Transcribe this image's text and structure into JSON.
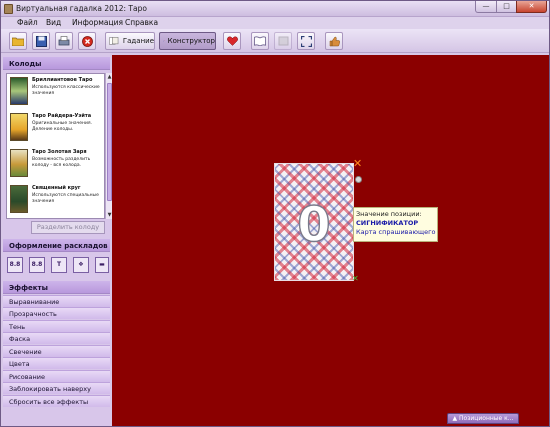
{
  "window": {
    "title": "Виртуальная гадалка 2012: Таро",
    "minimize_glyph": "—",
    "maximize_glyph": "□",
    "close_glyph": "✕"
  },
  "menu": [
    "Файл",
    "Вид",
    "Информация",
    "Справка"
  ],
  "toolbar": {
    "fortune_label": "Гадание",
    "constructor_label": "Конструктор",
    "icons": [
      "open-folder-icon",
      "save-icon",
      "print-icon",
      "stop-icon",
      "fortune-icon",
      "constructor-icon",
      "heart-icon",
      "book-icon",
      "disabled-icon",
      "fullscreen-icon",
      "thumbs-up-icon"
    ]
  },
  "sidebar": {
    "decks_header": "Колоды",
    "decks": [
      {
        "name": "Бриллиантовое Таро",
        "desc": "Используются классические значения"
      },
      {
        "name": "Таро Райдера-Уэйта",
        "desc": "Оригинальные значения. Деление колоды."
      },
      {
        "name": "Таро Золотая Заря",
        "desc": "Возможность разделить колоду - вся колода."
      },
      {
        "name": "Священный круг",
        "desc": "Используются специальные значения"
      }
    ],
    "split_button": "Разделить колоду",
    "layout_header": "Оформление раскладов",
    "effects_header": "Эффекты",
    "effects": [
      "Выравнивание",
      "Прозрачность",
      "Тень",
      "Фаска",
      "Свечение",
      "Цвета",
      "Рисование",
      "Заблокировать наверху",
      "Сбросить все эффекты"
    ]
  },
  "canvas": {
    "background_color": "#8b0000",
    "card_number": "0",
    "tooltip": {
      "line1": "Значение позиции:",
      "line2": "СИГНИФИКАТОР",
      "line3": "Карта спрашивающего"
    },
    "positional_tab": "▲ Позиционные к..."
  }
}
